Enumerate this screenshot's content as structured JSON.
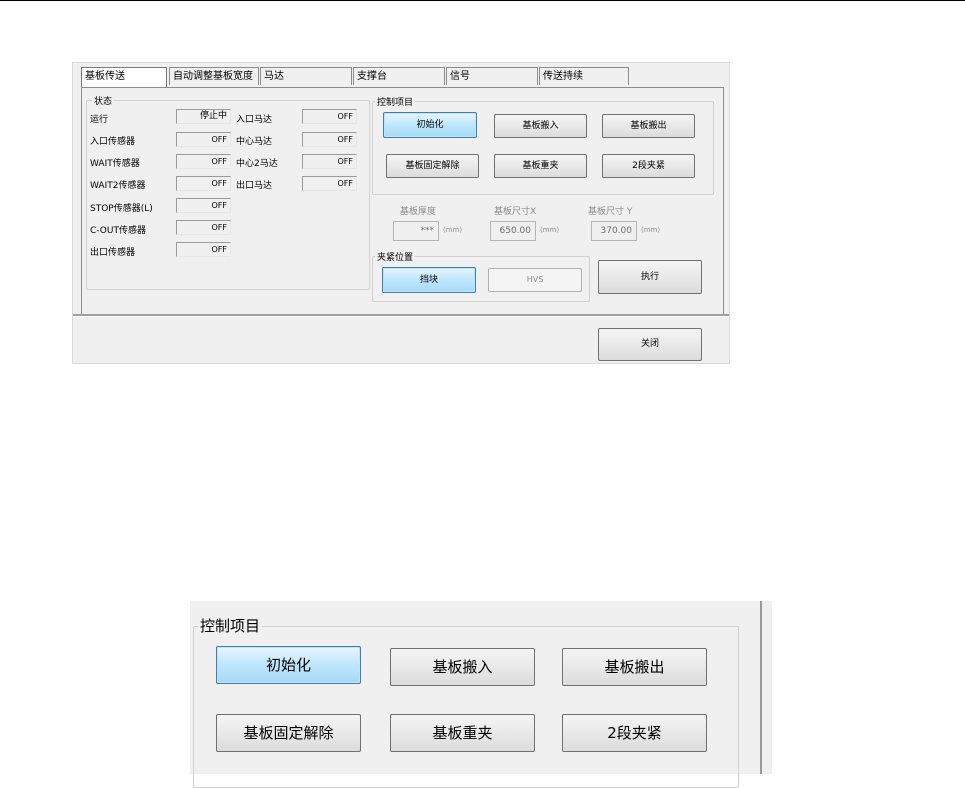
{
  "tabs": [
    "基板传送",
    "自动调整基板宽度",
    "马达",
    "支撑台",
    "信号",
    "传送持续"
  ],
  "status": {
    "title": "状态",
    "left": [
      {
        "label": "运行",
        "value": "停止中"
      },
      {
        "label": "入口传感器",
        "value": "OFF"
      },
      {
        "label": "WAIT传感器",
        "value": "OFF"
      },
      {
        "label": "WAIT2传感器",
        "value": "OFF"
      },
      {
        "label": "STOP传感器(L)",
        "value": "OFF"
      },
      {
        "label": "C-OUT传感器",
        "value": "OFF"
      },
      {
        "label": "出口传感器",
        "value": "OFF"
      }
    ],
    "right": [
      {
        "label": "入口马达",
        "value": "OFF"
      },
      {
        "label": "中心马达",
        "value": "OFF"
      },
      {
        "label": "中心2马达",
        "value": "OFF"
      },
      {
        "label": "出口马达",
        "value": "OFF"
      }
    ]
  },
  "control": {
    "title": "控制项目",
    "buttons": [
      "初始化",
      "基板搬入",
      "基板搬出",
      "基板固定解除",
      "基板重夹",
      "2段夹紧"
    ]
  },
  "board": {
    "thickness_label": "基板厚度",
    "thickness_value": "***",
    "thickness_unit": "(mm)",
    "size_x_label": "基板尺寸X",
    "size_x_value": "650.00",
    "size_x_unit": "(mm)",
    "size_y_label": "基板尺寸 Y",
    "size_y_value": "370.00",
    "size_y_unit": "(mm)"
  },
  "clamp": {
    "title": "夹紧位置",
    "option1": "挡块",
    "option2": "HVS"
  },
  "execute_label": "执行",
  "close_label": "关闭",
  "colors": {
    "dialog_bg": "#f0f0f0",
    "selected_button": "#bee6fd"
  }
}
